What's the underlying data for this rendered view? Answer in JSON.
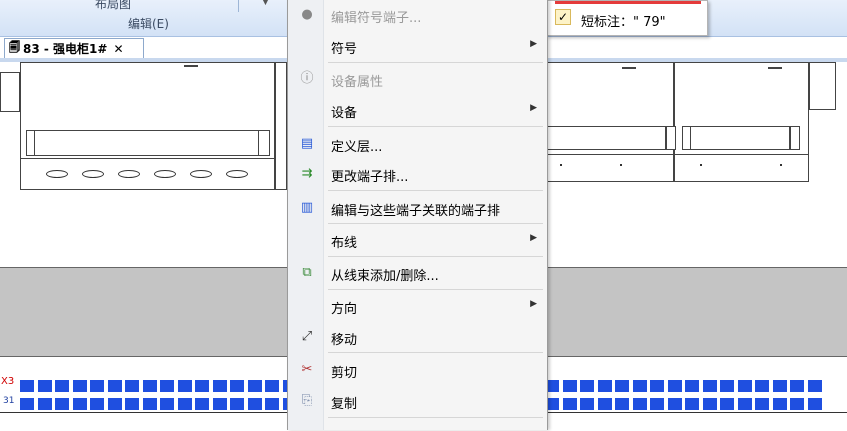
{
  "ribbon": {
    "group_label": "编辑(E)",
    "top_label": "布局图"
  },
  "doc_tab": {
    "title": "83 - 强电柜1#",
    "close": "✕",
    "icon": "document-icon"
  },
  "terminal_labels": {
    "red": "X3",
    "blue": "31"
  },
  "tooltip": {
    "check": "✓",
    "text": "短标注：\" 79\"",
    "accent_color": "#e43b3b"
  },
  "context_menu": {
    "items": [
      {
        "label": "编辑符号端子...",
        "icon": "disc-icon",
        "disabled": true,
        "submenu": false
      },
      {
        "label": "符号",
        "icon": "",
        "disabled": false,
        "submenu": true
      },
      {
        "label": "设备属性",
        "icon": "info-icon",
        "disabled": true,
        "submenu": false
      },
      {
        "label": "设备",
        "icon": "",
        "disabled": false,
        "submenu": true
      },
      {
        "label": "定义层...",
        "icon": "layer-icon",
        "disabled": false,
        "submenu": false
      },
      {
        "label": "更改端子排...",
        "icon": "terminal-strip-icon",
        "disabled": false,
        "submenu": false
      },
      {
        "label": "编辑与这些端子关联的端子排",
        "icon": "terminal-edit-icon",
        "disabled": false,
        "submenu": false
      },
      {
        "label": "布线",
        "icon": "",
        "disabled": false,
        "submenu": true
      },
      {
        "label": "从线束添加/删除...",
        "icon": "harness-icon",
        "disabled": false,
        "submenu": false
      },
      {
        "label": "方向",
        "icon": "",
        "disabled": false,
        "submenu": true
      },
      {
        "label": "移动",
        "icon": "move-icon",
        "disabled": false,
        "submenu": false
      },
      {
        "label": "剪切",
        "icon": "scissors-icon",
        "disabled": false,
        "submenu": false
      },
      {
        "label": "复制",
        "icon": "copy-icon",
        "disabled": false,
        "submenu": false
      }
    ]
  }
}
